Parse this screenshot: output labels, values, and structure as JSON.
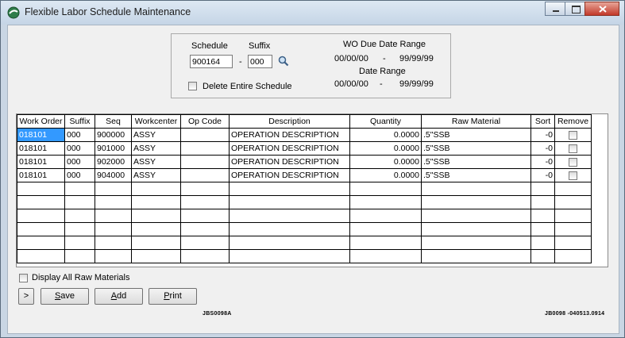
{
  "window": {
    "title": "Flexible Labor Schedule Maintenance"
  },
  "header": {
    "schedule_label": "Schedule",
    "suffix_label": "Suffix",
    "schedule_value": "900164",
    "dash": "-",
    "suffix_value": "000",
    "delete_label": "Delete Entire Schedule",
    "wo_due_label": "WO Due Date Range",
    "wo_due_from": "00/00/00",
    "wo_due_to": "99/99/99",
    "date_range_label": "Date Range",
    "date_from": "00/00/00",
    "date_to": "99/99/99"
  },
  "grid": {
    "columns": [
      "Work Order",
      "Suffix",
      "Seq",
      "Workcenter",
      "Op Code",
      "Description",
      "Quantity",
      "Raw Material",
      "Sort",
      "Remove"
    ],
    "rows": [
      {
        "work_order": "018101",
        "suffix": "000",
        "seq": "900000",
        "workcenter": "ASSY",
        "op_code": "",
        "description": "OPERATION DESCRIPTION",
        "quantity": "0.0000",
        "raw_material": ".5\"SSB",
        "sort": "-0"
      },
      {
        "work_order": "018101",
        "suffix": "000",
        "seq": "901000",
        "workcenter": "ASSY",
        "op_code": "",
        "description": "OPERATION DESCRIPTION",
        "quantity": "0.0000",
        "raw_material": ".5\"SSB",
        "sort": "-0"
      },
      {
        "work_order": "018101",
        "suffix": "000",
        "seq": "902000",
        "workcenter": "ASSY",
        "op_code": "",
        "description": "OPERATION DESCRIPTION",
        "quantity": "0.0000",
        "raw_material": ".5\"SSB",
        "sort": "-0"
      },
      {
        "work_order": "018101",
        "suffix": "000",
        "seq": "904000",
        "workcenter": "ASSY",
        "op_code": "",
        "description": "OPERATION DESCRIPTION",
        "quantity": "0.0000",
        "raw_material": ".5\"SSB",
        "sort": "-0"
      }
    ]
  },
  "footer": {
    "display_all_label": "Display All Raw Materials",
    "expand_label": ">",
    "save_first": "S",
    "save_rest": "ave",
    "add_first": "A",
    "add_rest": "dd",
    "print_first": "P",
    "print_rest": "rint",
    "code_left": "JBS0098A",
    "code_right": "JB0098 -040513.0914"
  }
}
